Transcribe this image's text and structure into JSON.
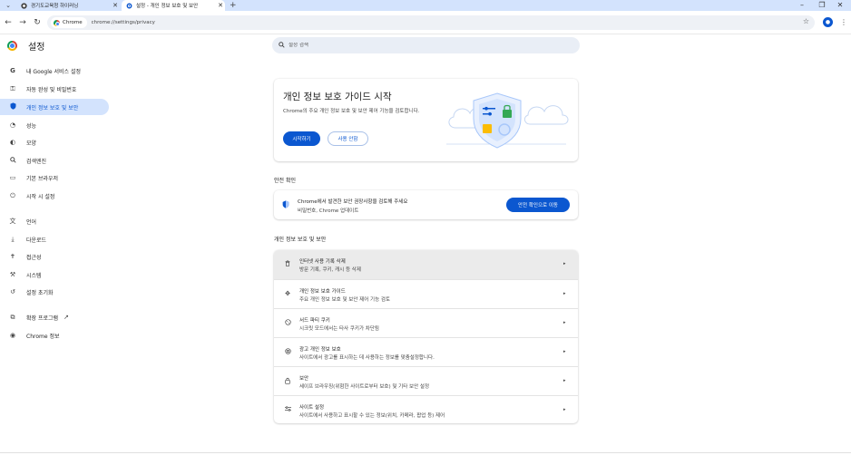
{
  "tabs": [
    {
      "title": "경기도교육청 하이러닝",
      "active": false,
      "favicon": "tab-favicon"
    },
    {
      "title": "설정 - 개인 정보 보호 및 보안",
      "active": true,
      "favicon": "gear-icon"
    }
  ],
  "toolbar": {
    "site_chip": "Chrome",
    "url": "chrome://settings/privacy"
  },
  "header": {
    "title": "설정",
    "search_placeholder": "설정 검색"
  },
  "sidebar": {
    "items": [
      {
        "label": "내 Google 서비스 설정",
        "icon": "google-icon"
      },
      {
        "label": "자동 완성 및 비밀번호",
        "icon": "key-icon"
      },
      {
        "label": "개인 정보 보호 및 보안",
        "icon": "shield-icon",
        "selected": true
      },
      {
        "label": "성능",
        "icon": "speedometer-icon"
      },
      {
        "label": "모양",
        "icon": "palette-icon"
      },
      {
        "label": "검색엔진",
        "icon": "search-icon"
      },
      {
        "label": "기본 브라우저",
        "icon": "browser-window-icon"
      },
      {
        "label": "시작 시 설정",
        "icon": "power-icon"
      },
      {
        "label": "언어",
        "icon": "translate-icon"
      },
      {
        "label": "다운로드",
        "icon": "download-icon"
      },
      {
        "label": "접근성",
        "icon": "accessibility-icon"
      },
      {
        "label": "시스템",
        "icon": "wrench-icon"
      },
      {
        "label": "설정 초기화",
        "icon": "reset-icon"
      },
      {
        "label": "확장 프로그램",
        "icon": "puzzle-icon"
      },
      {
        "label": "Chrome 정보",
        "icon": "chrome-icon"
      }
    ]
  },
  "guide": {
    "title": "개인 정보 보호 가이드 시작",
    "description": "Chrome의 주요 개인 정보 보호 및 보안 제어 기능을 검토합니다.",
    "start_label": "시작하기",
    "dismiss_label": "사용 안함"
  },
  "safety": {
    "section_label": "안전 확인",
    "title": "Chrome에서 발견한 보안 권장사항을 검토해 주세요",
    "subtitle": "비밀번호, Chrome 업데이트",
    "button_label": "안전 확인으로 이동"
  },
  "privacy": {
    "section_label": "개인 정보 보호 및 보안",
    "rows": [
      {
        "title": "인터넷 사용 기록 삭제",
        "subtitle": "방문 기록, 쿠키, 캐시 등 삭제",
        "icon": "trash-icon"
      },
      {
        "title": "개인 정보 보호 가이드",
        "subtitle": "주요 개인 정보 보호 및 보안 제어 기능 검토",
        "icon": "guide-icon"
      },
      {
        "title": "서드 파티 쿠키",
        "subtitle": "시크릿 모드에서는 타사 쿠키가 차단됨",
        "icon": "cookie-icon"
      },
      {
        "title": "광고 개인 정보 보호",
        "subtitle": "사이트에서 광고를 표시하는 데 사용하는 정보를 맞춤설정합니다.",
        "icon": "ad-privacy-icon"
      },
      {
        "title": "보안",
        "subtitle": "세이프 브라우징(위험한 사이트로부터 보호) 및 기타 보안 설정",
        "icon": "lock-icon"
      },
      {
        "title": "사이트 설정",
        "subtitle": "사이트에서 사용하고 표시할 수 있는 정보(위치, 카메라, 팝업 등) 제어",
        "icon": "sliders-icon"
      }
    ]
  },
  "colors": {
    "accent": "#0b57d0",
    "selected_bg": "#d3e3fd",
    "tabstrip_bg": "#d3e3fd"
  }
}
